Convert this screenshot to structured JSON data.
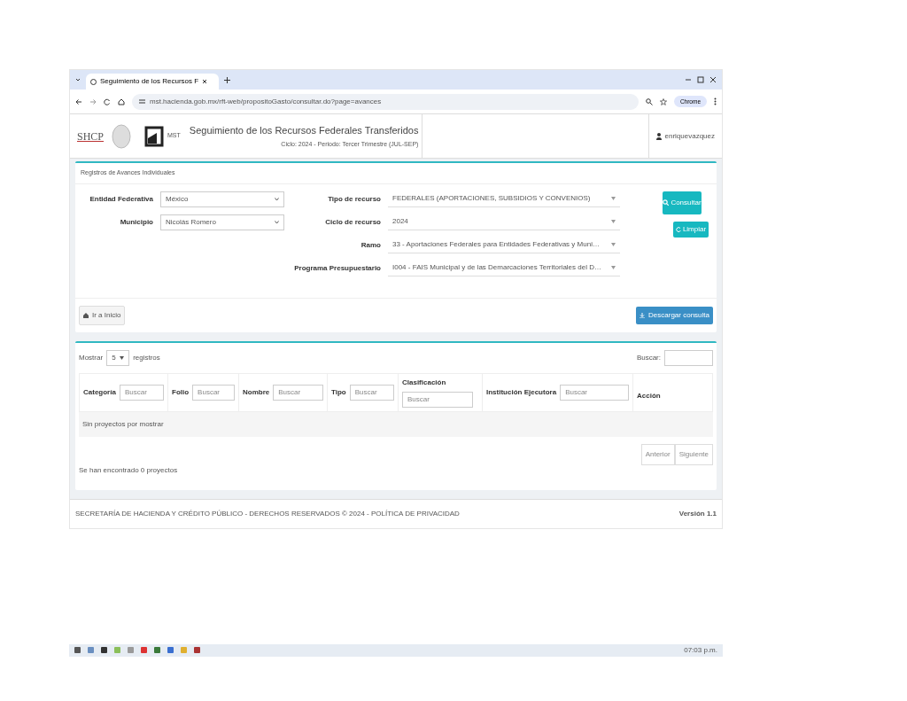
{
  "browser": {
    "tab_title": "Seguimiento de los Recursos F",
    "url": "mst.hacienda.gob.mx/rft-web/propositoGasto/consultar.do?page=avances",
    "profile": "Chrome"
  },
  "header": {
    "logo_text": "SHCP",
    "mst_text": "MST",
    "title": "Seguimiento de los Recursos Federales Transferidos",
    "subtitle": "Ciclo: 2024 - Periodo: Tercer Trimestre (JUL-SEP)",
    "user": "enriquevazquez"
  },
  "filters": {
    "title": "Registros de Avances Individuales",
    "left_fields": [
      {
        "label": "Entidad Federativa",
        "value": "México"
      },
      {
        "label": "Municipio",
        "value": "Nicolás Romero"
      }
    ],
    "right_fields": [
      {
        "label": "Tipo de recurso",
        "value": "FEDERALES (APORTACIONES, SUBSIDIOS Y CONVENIOS)"
      },
      {
        "label": "Ciclo de recurso",
        "value": "2024"
      },
      {
        "label": "Ramo",
        "value": "33 - Aportaciones Federales para Entidades Federativas y Muni…"
      },
      {
        "label": "Programa Presupuestario",
        "value": "I004 - FAIS Municipal y de las Demarcaciones Territoriales del D…"
      }
    ],
    "consult_button": "Consultar",
    "clear_button": "Limpiar",
    "home_button": "Ir a Inicio",
    "download_button": "Descargar consulta"
  },
  "results": {
    "show_label": "Mostrar",
    "page_size": "5",
    "records_label": "registros",
    "search_label": "Buscar:",
    "columns": [
      {
        "label": "Categoría",
        "placeholder": "Buscar"
      },
      {
        "label": "Folio",
        "placeholder": "Buscar"
      },
      {
        "label": "Nombre",
        "placeholder": "Buscar"
      },
      {
        "label": "Tipo",
        "placeholder": "Buscar"
      },
      {
        "label": "Clasificación",
        "placeholder": "Buscar",
        "stacked": true
      },
      {
        "label": "Institución Ejecutora",
        "placeholder": "Buscar"
      },
      {
        "label": "Acción"
      }
    ],
    "empty_message": "Sin proyectos por mostrar",
    "pagination": [
      "Anterior",
      "Siguiente"
    ],
    "info": "Se han encontrado 0 proyectos"
  },
  "footer": {
    "left": "SECRETARÍA DE HACIENDA Y CRÉDITO PÚBLICO - DERECHOS RESERVADOS © 2024 - POLÍTICA DE PRIVACIDAD",
    "version": "Versión 1.1"
  },
  "taskbar": {
    "time": "07:03 p.m."
  }
}
